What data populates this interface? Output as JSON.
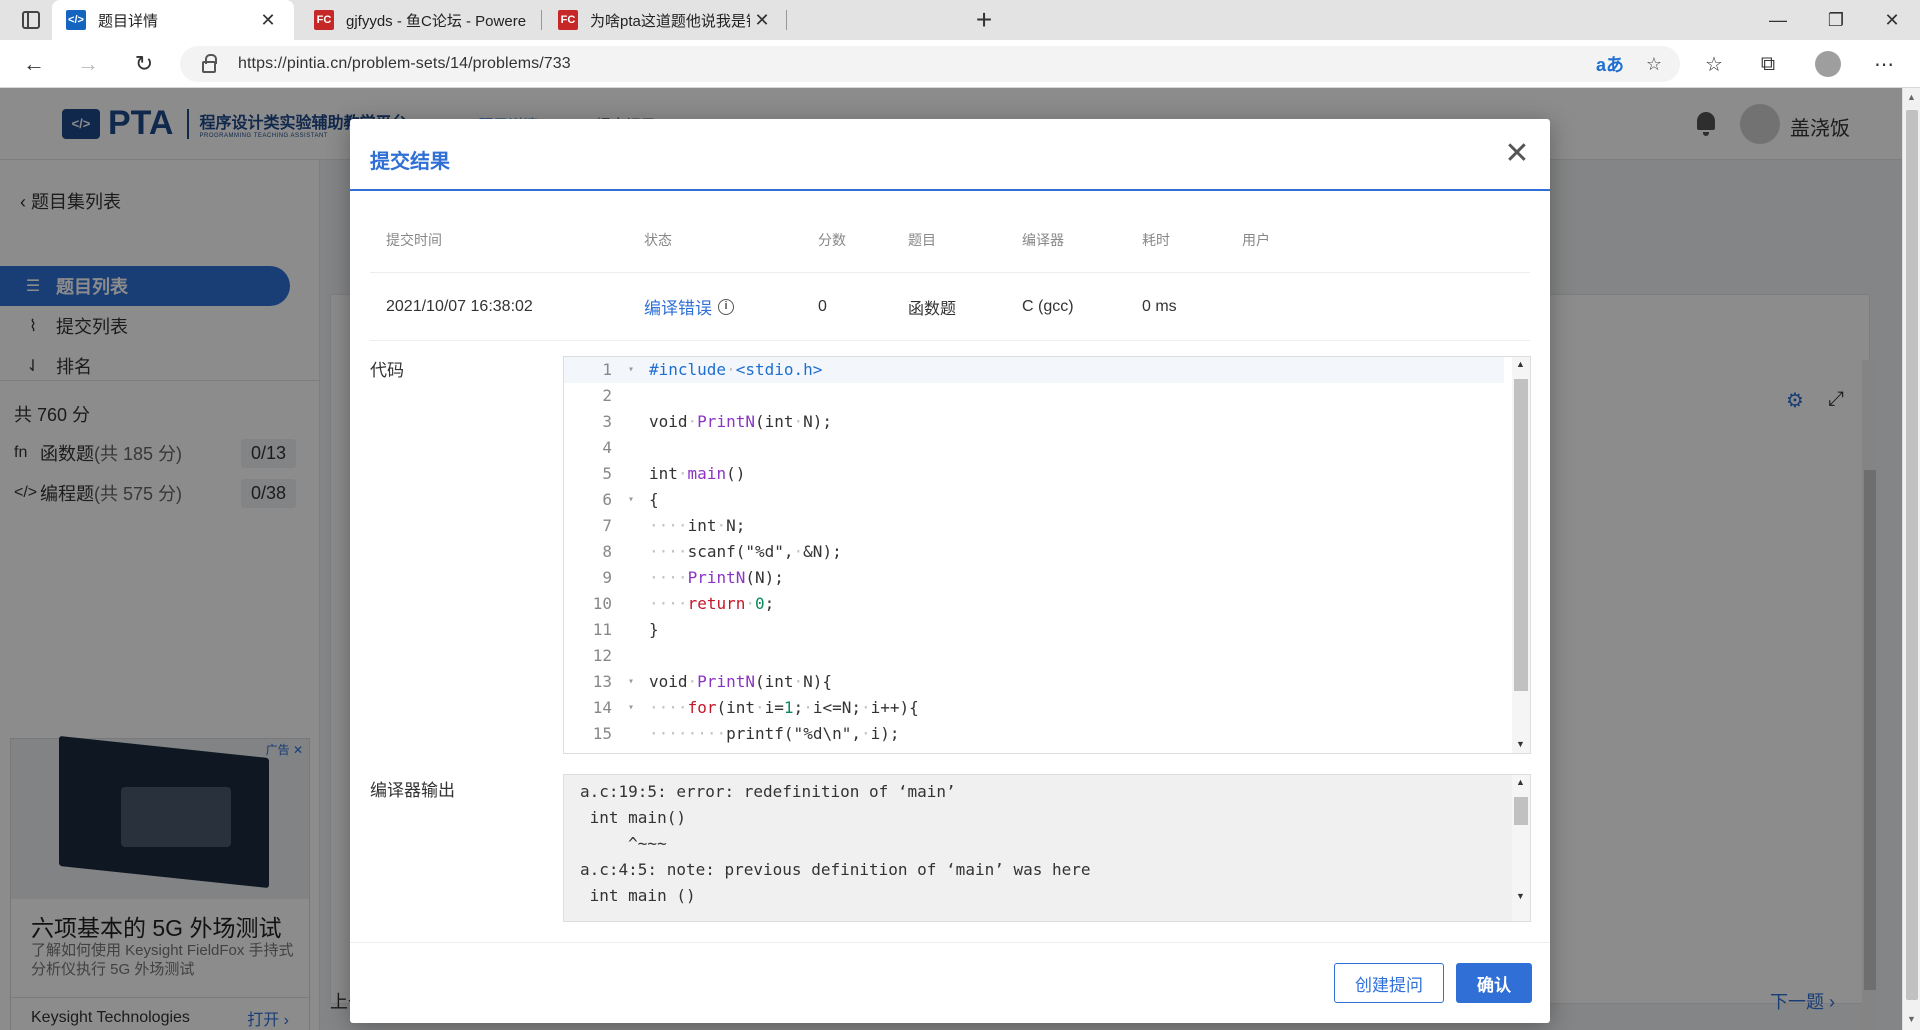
{
  "browser": {
    "tabs": [
      {
        "title": "题目详情",
        "icon": "pta-favicon",
        "active": true
      },
      {
        "title": "gjfyyds - 鱼C论坛 - Powered by Discuz!",
        "icon": "fc-favicon",
        "active": false
      },
      {
        "title": "为啥pta这道题他说我是错的,C\\C++交流,鱼C论坛",
        "icon": "fc-favicon",
        "active": false
      }
    ],
    "fav_pta_text": "</>",
    "fav_fc_text": "FC",
    "url": "https://pintia.cn/problem-sets/14/problems/733"
  },
  "header": {
    "logo_mark": "</>",
    "logo_text": "PTA",
    "logo_sub": "程序设计类实验辅助教学平台",
    "logo_sub_en": "PROGRAMMING TEACHING ASSISTANT",
    "tab_1": "题目详情",
    "tab_2": "提交记录",
    "username": "盖浇饭"
  },
  "sidebar": {
    "back": "题目集列表",
    "items": [
      {
        "label": "题目列表",
        "active": true
      },
      {
        "label": "提交列表",
        "active": false
      },
      {
        "label": "排名",
        "active": false
      }
    ],
    "total": "共 760 分",
    "categories": [
      {
        "icon": "fn",
        "label": "函数题",
        "score": "(共 185 分)",
        "progress": "0/13"
      },
      {
        "icon": "</>",
        "label": "编程题",
        "score": "(共 575 分)",
        "progress": "0/38"
      }
    ]
  },
  "ad": {
    "tag": "广告",
    "title": "六项基本的 5G 外场测试",
    "desc": "了解如何使用 Keysight FieldFox 手持式分析仪执行 5G 外场测试",
    "sponsor": "Keysight Technologies",
    "open": "打开"
  },
  "page": {
    "prev": "上一题",
    "next": "下一题"
  },
  "modal": {
    "title": "提交结果",
    "columns": [
      "提交时间",
      "状态",
      "分数",
      "题目",
      "编译器",
      "耗时",
      "用户"
    ],
    "row": {
      "time": "2021/10/07 16:38:02",
      "status": "编译错误",
      "score": "0",
      "problem": "函数题",
      "compiler": "C (gcc)",
      "duration": "0 ms",
      "user": ""
    },
    "code_label": "代码",
    "output_label": "编译器输出",
    "code_lines": [
      "#include·<stdio.h>",
      "",
      "void·PrintN(int·N);",
      "",
      "int·main()",
      "{",
      "····int·N;",
      "····scanf(\"%d\",·&N);",
      "····PrintN(N);",
      "····return·0;",
      "}",
      "",
      "void·PrintN(int·N){",
      "····for(int·i=1;·i<=N;·i++){",
      "········printf(\"%d\\n\",·i);"
    ],
    "output_lines": [
      "a.c:19:5: error: redefinition of ‘main’",
      " int main()",
      "     ^~~~",
      "a.c:4:5: note: previous definition of ‘main’ was here",
      " int main ()"
    ],
    "btn_ask": "创建提问",
    "btn_ok": "确认"
  },
  "colors": {
    "accent": "#2f6fd6",
    "brand": "#1f4a8c"
  }
}
